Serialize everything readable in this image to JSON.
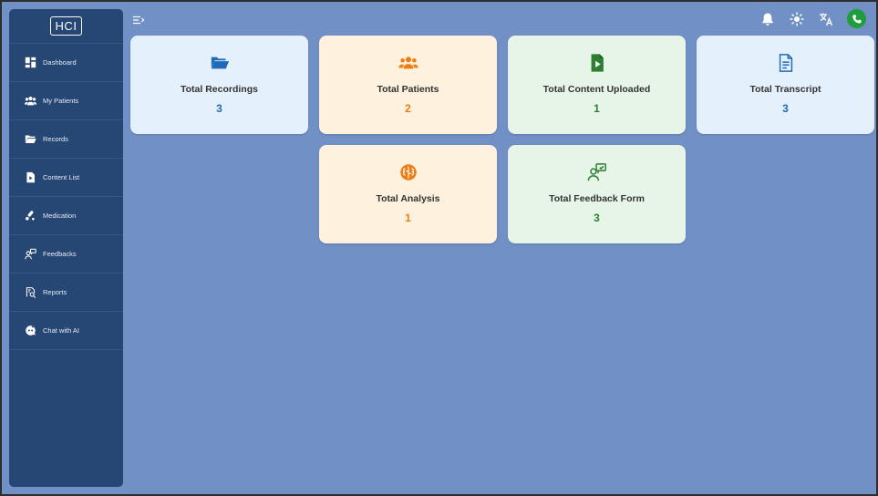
{
  "logo": "HCI",
  "sidebar": {
    "items": [
      {
        "label": "Dashboard",
        "icon": "dashboard-icon"
      },
      {
        "label": "My Patients",
        "icon": "patients-icon"
      },
      {
        "label": "Records",
        "icon": "folder-icon"
      },
      {
        "label": "Content List",
        "icon": "video-file-icon"
      },
      {
        "label": "Medication",
        "icon": "medication-icon"
      },
      {
        "label": "Feedbacks",
        "icon": "feedback-icon"
      },
      {
        "label": "Reports",
        "icon": "reports-icon"
      },
      {
        "label": "Chat with AI",
        "icon": "chat-ai-icon"
      }
    ]
  },
  "topbar": {
    "icons": [
      "menu-toggle-icon",
      "notification-bell-icon",
      "theme-sun-icon",
      "translate-icon",
      "phone-call-icon"
    ]
  },
  "cards": [
    {
      "title": "Total Recordings",
      "value": "3",
      "icon": "folder-open-icon",
      "accent": "#1e6bb8"
    },
    {
      "title": "Total Patients",
      "value": "2",
      "icon": "users-icon",
      "accent": "#f07d13"
    },
    {
      "title": "Total Content Uploaded",
      "value": "1",
      "icon": "video-file-icon",
      "accent": "#2e7d32"
    },
    {
      "title": "Total Transcript",
      "value": "3",
      "icon": "document-icon",
      "accent": "#1e6bb8"
    },
    {
      "title": "Total Analysis",
      "value": "1",
      "icon": "analysis-brain-icon",
      "accent": "#f07d13"
    },
    {
      "title": "Total Feedback Form",
      "value": "3",
      "icon": "feedback-icon",
      "accent": "#2e7d32"
    }
  ],
  "colors": {
    "background": "#7190c6",
    "sidebar": "#264673",
    "call_button": "#1f9d3a"
  }
}
